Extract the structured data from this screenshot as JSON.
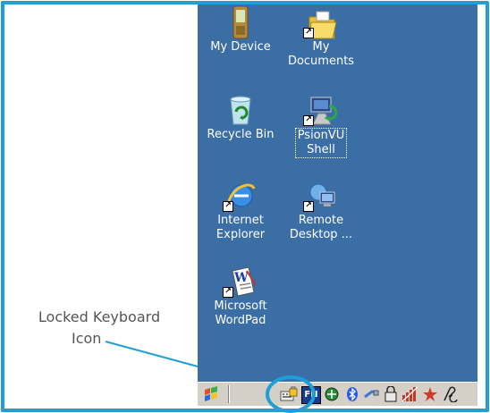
{
  "callout": {
    "line1": "Locked Keyboard",
    "line2": "Icon"
  },
  "desktop": {
    "icons": [
      {
        "label_1": "My Device",
        "label_2": ""
      },
      {
        "label_1": "My",
        "label_2": "Documents"
      },
      {
        "label_1": "Recycle Bin",
        "label_2": ""
      },
      {
        "label_1": "PsionVU",
        "label_2": "Shell"
      },
      {
        "label_1": "Internet",
        "label_2": "Explorer"
      },
      {
        "label_1": "Remote",
        "label_2": "Desktop ..."
      },
      {
        "label_1": "Microsoft",
        "label_2": "WordPad"
      }
    ]
  },
  "taskbar": {
    "fn_label": "FN",
    "tray_icons": [
      "start-flag-icon",
      "locked-keyboard-icon",
      "fn-key-icon",
      "network-icon",
      "bluetooth-icon",
      "usb-connection-icon",
      "battery-lock-icon",
      "signal-icon",
      "power-icon",
      "stylus-icon"
    ]
  },
  "colors": {
    "accent": "#1f9fd8",
    "desktop": "#3a6ea5",
    "taskbar": "#d4d0c8"
  }
}
